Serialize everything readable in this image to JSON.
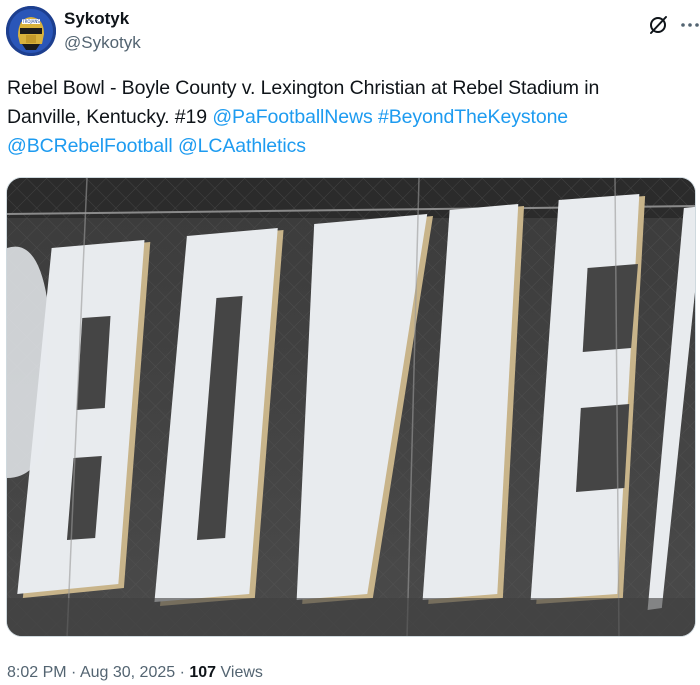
{
  "author": {
    "display_name": "Sykotyk",
    "handle": "@Sykotyk",
    "avatar_icon": "avatar-helmet-icon"
  },
  "header_icons": {
    "grok": "grok-slash-icon",
    "more": "more-dots-icon"
  },
  "tweet": {
    "text_line1": "Rebel Bowl - Boyle County v. Lexington Christian at Rebel Stadium in",
    "text_line2_prefix": "Danville, Kentucky. #19 ",
    "mention_pafootball": "@PaFootballNews",
    "hashtag_beyond": "#BeyondTheKeystone",
    "mention_bcrebel": "@BCRebelFootball",
    "mention_lca": "@LCAathletics",
    "image_banner_text": "BOYLE"
  },
  "meta": {
    "time": "8:02 PM",
    "separator": "·",
    "date": "Aug 30, 2025",
    "views_count": "107",
    "views_label": "Views"
  },
  "colors": {
    "link": "#1d9bf0",
    "text": "#0f1419",
    "secondary": "#536471",
    "banner_dark": "#454545",
    "banner_letters": "#e8ebee",
    "banner_outline": "#c8b48a"
  }
}
